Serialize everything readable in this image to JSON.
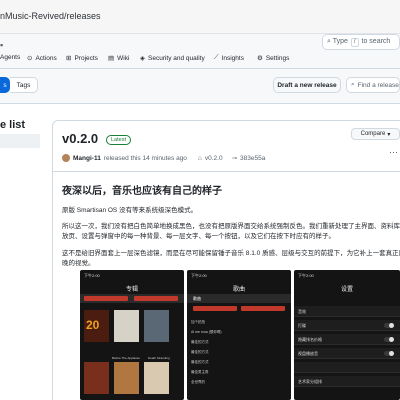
{
  "browser": {
    "url": "nMusic-Revived/releases"
  },
  "header": {
    "search_placeholder": "Type / to search",
    "search_prefix": "Type",
    "search_key": "/",
    "search_suffix": "to search",
    "nav": [
      {
        "label": "Agents"
      },
      {
        "label": "Actions"
      },
      {
        "label": "Projects"
      },
      {
        "label": "Wiki"
      },
      {
        "label": "Security and quality"
      },
      {
        "label": "Insights"
      },
      {
        "label": "Settings"
      }
    ]
  },
  "subnav": {
    "releases_label": "s",
    "tags_label": "Tags",
    "draft_label": "Draft a new release",
    "find_placeholder": "Find a release"
  },
  "left": {
    "title": "e list"
  },
  "release": {
    "version": "v0.2.0",
    "badge": "Latest",
    "compare_label": "Compare",
    "author": "Mangi-11",
    "released_text": "released this 14 minutes ago",
    "tag": "v0.2.0",
    "commit": "383e55a",
    "heading": "夜深以后，音乐也应该有自己的样子",
    "para1": "原版 Smartisan OS 没有等来系统级深色模式。",
    "para2a": "所以这一次，我们没有把白色简单地换成黑色，也没有把原版界面交给系统强制反色。我们重新处理了主界面、资料库",
    "para2b": "放页、设置与弹窗中的每一种背景、每一层文字、每一个按钮，以及它们在按下时应有的样子。",
    "para3a": "这不是给旧界面套上一层深色滤镜，而是在尽可能保留锤子音乐 8.1.0 质感、层级与交互的前提下，为它补上一套真正属",
    "para3b": "晚的视觉。"
  },
  "phones": {
    "album": {
      "status": "下午2:00",
      "title": "专辑",
      "items": [
        "20",
        "Before The Applause",
        "Death Stranding"
      ]
    },
    "songs": {
      "status": "下午2:00",
      "title": "歌曲",
      "tab": "歌曲",
      "rows": [
        "加个拍拍",
        "Al me mua (想你啊)",
        "最佳的方式",
        "最佳的方式",
        "最佳的方式",
        "最佳男主角",
        "全世界的"
      ]
    },
    "settings": {
      "status": "下午2:00",
      "title": "设置",
      "rows": [
        "音效",
        "打碟",
        "隐藏排名价格",
        "视盘播放音",
        "",
        "艺术家分组排"
      ]
    }
  },
  "colors": {
    "accent": "#0969da",
    "latest": "#1a7f37",
    "phone_bg": "#141414",
    "phone_red": "#c0392b"
  }
}
